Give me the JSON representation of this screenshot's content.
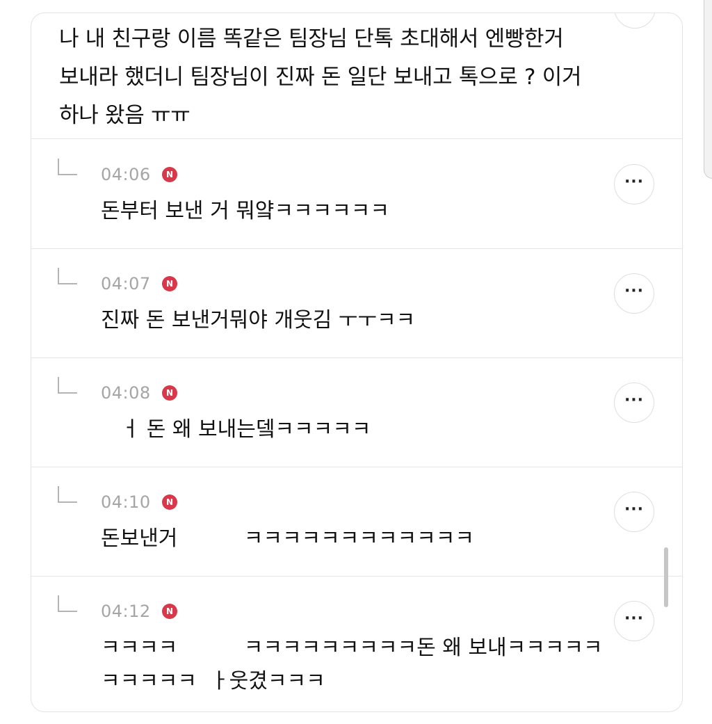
{
  "post": {
    "text": "나 내 친구랑 이름 똑같은 팀장님 단톡 초대해서 엔빵한거\n보내라 했더니 팀장님이 진짜 돈 일단 보내고 톡으로 ? 이거\n하나 왔음 ㅠㅠ"
  },
  "replies": [
    {
      "time": "04:06",
      "badge": "N",
      "text": "돈부터 보낸 거 뭐얔ㅋㅋㅋㅋㅋㅋ",
      "more": "···"
    },
    {
      "time": "04:07",
      "badge": "N",
      "text": "진짜 돈 보낸거뭐야 개웃김 ㅜㅜㅋㅋ",
      "more": "···"
    },
    {
      "time": "04:08",
      "badge": "N",
      "text": "   ㅓ 돈 왜 보내는뎈ㅋㅋㅋㅋㅋ",
      "more": "···"
    },
    {
      "time": "04:10",
      "badge": "N",
      "text": "돈보낸거          ㅋㅋㅋㅋㅋㅋㅋㅋㅋㅋㅋㅋ",
      "more": "···"
    },
    {
      "time": "04:12",
      "badge": "N",
      "text": "ㅋㅋㅋㅋ          ㅋㅋㅋㅋㅋㅋㅋㅋㅋ돈 왜 보내ㅋㅋㅋㅋㅋ\nㅋㅋㅋㅋㅋ  ㅏ웃겼ㅋㅋㅋ",
      "more": "···"
    }
  ]
}
